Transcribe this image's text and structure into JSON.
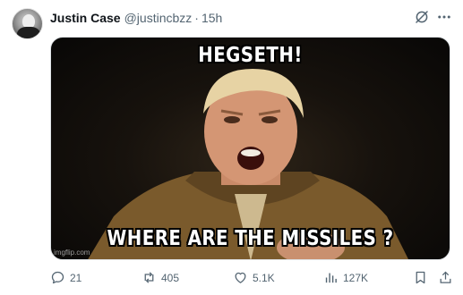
{
  "post": {
    "author_name": "Justin Case",
    "author_handle": "@justincbzz",
    "separator": "·",
    "timestamp": "15h"
  },
  "media": {
    "caption_top": "HEGSETH!",
    "caption_bottom": "WHERE ARE THE MISSILES ?",
    "watermark": "imgflip.com"
  },
  "actions": {
    "replies": "21",
    "reposts": "405",
    "likes": "5.1K",
    "views": "127K"
  },
  "icons": [
    "grok-icon",
    "more-icon",
    "reply-icon",
    "repost-icon",
    "like-icon",
    "views-icon",
    "bookmark-icon",
    "share-icon"
  ],
  "colors": {
    "text": "#0f1419",
    "muted": "#536471"
  }
}
